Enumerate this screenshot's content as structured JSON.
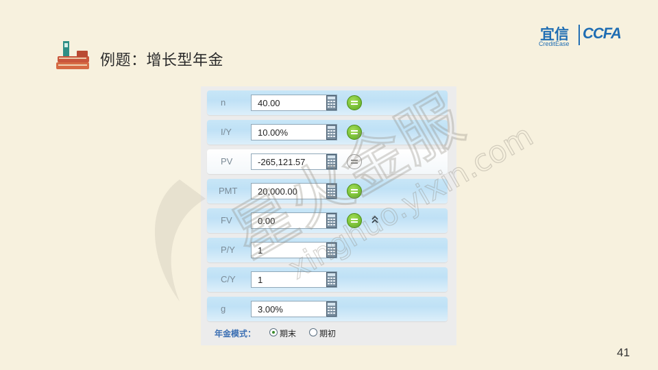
{
  "slide": {
    "title": "例题：增长型年金",
    "page_number": "41"
  },
  "logo": {
    "cn": "宜信",
    "en": "CreditEase",
    "ccfa": "CCFA"
  },
  "calculator": {
    "rows": [
      {
        "label": "n",
        "value": "40.00",
        "compute": "green"
      },
      {
        "label": "I/Y",
        "value": "10.00%",
        "compute": "green"
      },
      {
        "label": "PV",
        "value": "-265,121.57",
        "compute": "grey"
      },
      {
        "label": "PMT",
        "value": "20,000.00",
        "compute": "green"
      },
      {
        "label": "FV",
        "value": "0.00",
        "compute": "green"
      },
      {
        "label": "P/Y",
        "value": "1"
      },
      {
        "label": "C/Y",
        "value": "1"
      },
      {
        "label": "g",
        "value": "3.00%"
      }
    ],
    "mode": {
      "label": "年金模式：",
      "options": [
        "期末",
        "期初"
      ],
      "selected": "期末"
    }
  },
  "watermark": {
    "text": "星火金服",
    "url": "xinghuo.yixin.com"
  },
  "colors": {
    "background": "#f7f1de",
    "row_blue": "#c8e6f7",
    "compute_green": "#6cbf2a",
    "logo_blue": "#1f6db3"
  }
}
